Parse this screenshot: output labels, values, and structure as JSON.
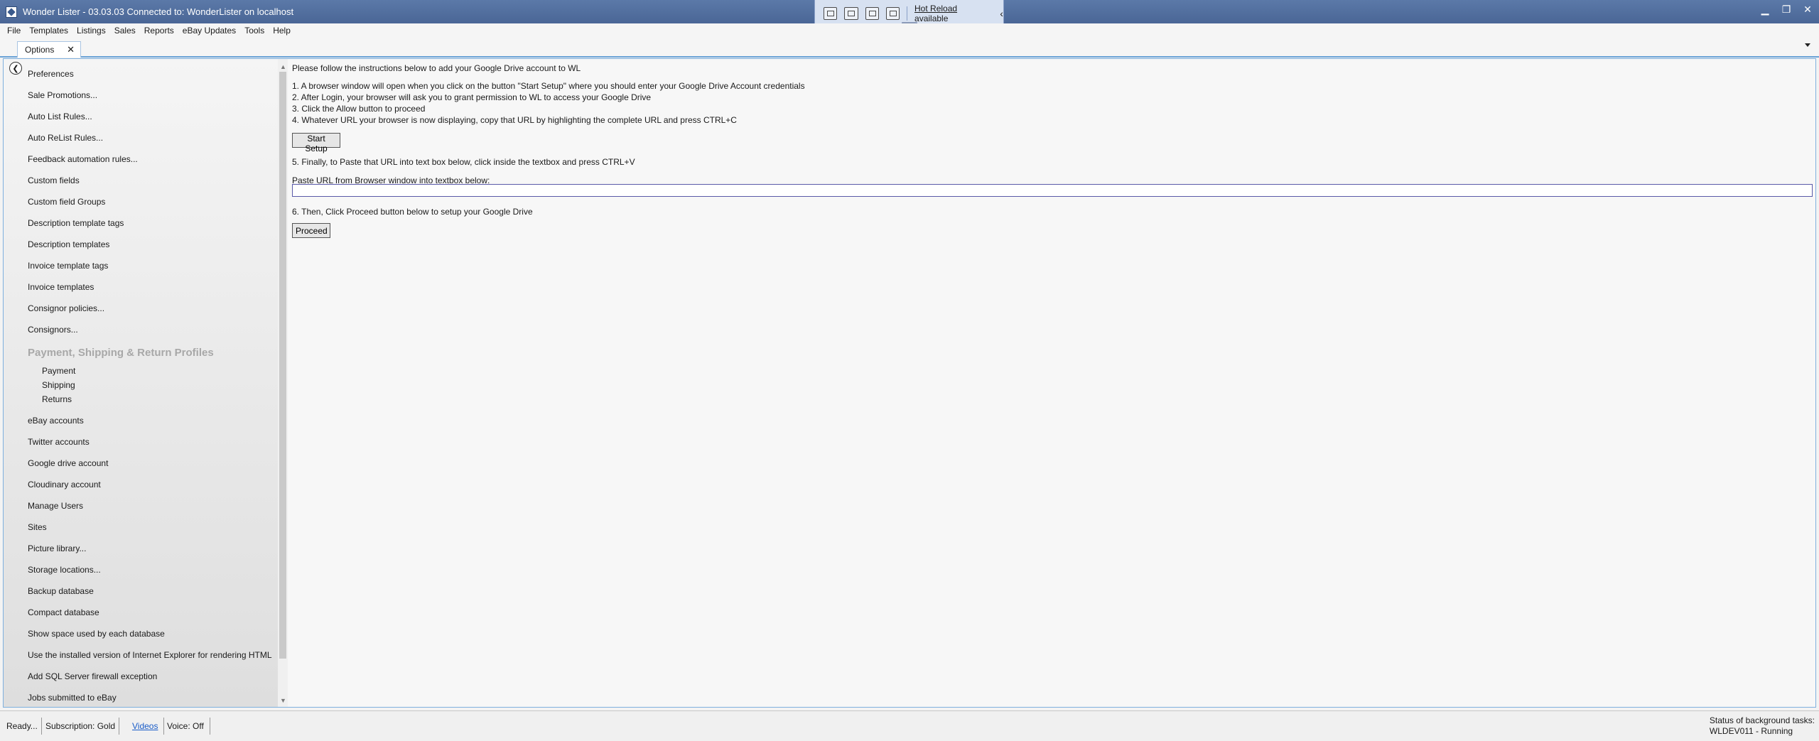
{
  "window": {
    "title": "Wonder Lister - 03.03.03 Connected to: WonderLister on localhost",
    "controls": [
      "minimize-icon",
      "restore-icon",
      "close-icon"
    ]
  },
  "hot_reload": {
    "link": "Hot Reload",
    "text": "available",
    "icons": [
      "live-visual-tree-icon",
      "select-element-icon",
      "display-layout-adorners-icon",
      "track-focused-element-icon"
    ]
  },
  "menu": [
    "File",
    "Templates",
    "Listings",
    "Sales",
    "Reports",
    "eBay Updates",
    "Tools",
    "Help"
  ],
  "tab": {
    "label": "Options",
    "close": "✕"
  },
  "sidebar": {
    "items": [
      "Preferences",
      "Sale Promotions...",
      "Auto List Rules...",
      "Auto ReList Rules...",
      "Feedback automation rules...",
      "Custom fields",
      "Custom field Groups",
      "Description template tags",
      "Description templates",
      "Invoice template tags",
      "Invoice templates",
      "Consignor policies...",
      "Consignors..."
    ],
    "section_title": "Payment, Shipping & Return Profiles",
    "section_items": [
      "Payment",
      "Shipping",
      "Returns"
    ],
    "items2": [
      "eBay accounts",
      "Twitter accounts",
      "Google drive account",
      "Cloudinary account",
      "Manage Users",
      "Sites",
      "Picture library...",
      "Storage locations...",
      "Backup database",
      "Compact database",
      "Show space used by each database",
      "Use the installed version of Internet Explorer for rendering HTML",
      "Add SQL Server firewall exception",
      "Jobs submitted to eBay"
    ]
  },
  "content": {
    "intro": "Please follow the instructions below to add your Google Drive account to WL",
    "steps": [
      "1. A browser window will open when you click on the button \"Start Setup\" where you should enter your Google Drive Account credentials",
      "2. After Login, your browser will ask you to grant permission to WL to access your Google Drive",
      "3. Click the Allow button to proceed",
      "4. Whatever URL your browser is now displaying, copy that URL by highlighting the complete URL and press CTRL+C"
    ],
    "start_button": "Start Setup",
    "step5": "5. Finally, to Paste that URL into text box below, click inside the textbox and press CTRL+V",
    "paste_label": "Paste URL from Browser window into textbox below:",
    "url_value": "",
    "step6": "6. Then, Click Proceed button below to setup your Google Drive",
    "proceed_button": "Proceed"
  },
  "status": {
    "ready": "Ready...",
    "subscription": "Subscription: Gold",
    "videos": "Videos",
    "voice": "Voice:  Off",
    "bg_tasks_label": "Status of background tasks:",
    "bg_tasks_value": "WLDEV011 - Running"
  }
}
